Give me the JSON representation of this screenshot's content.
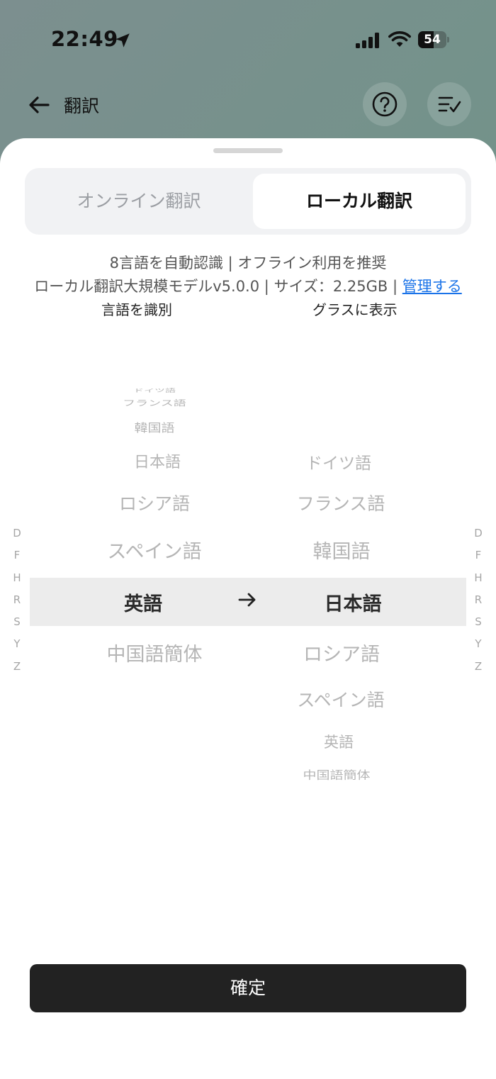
{
  "status_bar": {
    "time": "22:49",
    "battery": "54",
    "battery_level": 0.54
  },
  "nav": {
    "title": "翻訳"
  },
  "tabs": [
    {
      "label": "オンライン翻訳",
      "active": false
    },
    {
      "label": "ローカル翻訳",
      "active": true
    }
  ],
  "info": {
    "line1": "8言語を自動認識 | オフライン利用を推奨",
    "line2_prefix": "ローカル翻訳大規模モデルv5.0.0 | サイズ：2.25GB | ",
    "manage_link": "管理する"
  },
  "columns": {
    "source_header": "言語を識別",
    "target_header": "グラスに表示"
  },
  "source_languages": [
    "ドイツ語",
    "フランス語",
    "韓国語",
    "日本語",
    "ロシア語",
    "スペイン語",
    "英語",
    "中国語簡体"
  ],
  "target_languages": [
    "ドイツ語",
    "フランス語",
    "韓国語",
    "日本語",
    "ロシア語",
    "スペイン語",
    "英語",
    "中国語簡体"
  ],
  "source_selected": "英語",
  "target_selected": "日本語",
  "index_letters": [
    "D",
    "F",
    "H",
    "R",
    "S",
    "Y",
    "Z"
  ],
  "confirm_label": "確定"
}
